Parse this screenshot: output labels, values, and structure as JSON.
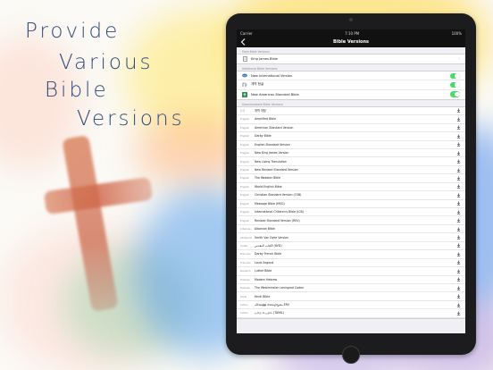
{
  "promo": {
    "line1": "Provide",
    "line2": "Various",
    "line3": "Bible",
    "line4": "Versions"
  },
  "status_bar": {
    "carrier": "Carrier",
    "time": "7:10 PM",
    "battery": "100%"
  },
  "nav": {
    "title": "Bible Versions",
    "back_icon": "chevron-left-icon"
  },
  "main_bible": {
    "header": "Main Bible Versions",
    "item": {
      "label": "King James Bible",
      "icon": "book-icon"
    }
  },
  "additional": {
    "header": "Additional Bible Versions",
    "items": [
      {
        "label": "New International Version",
        "icon": "niv-logo-icon",
        "enabled": true
      },
      {
        "label": "개역 한글",
        "icon": "korean-bible-icon",
        "enabled": true
      },
      {
        "label": "New American Standard Bible",
        "icon": "nasb-logo-icon",
        "enabled": true
      }
    ]
  },
  "downloadable": {
    "header": "Downloadable Bible Versions",
    "download_icon": "download-icon",
    "items": [
      {
        "lang": "한국",
        "name": "개역 개정"
      },
      {
        "lang": "English",
        "name": "Amplified Bible"
      },
      {
        "lang": "English",
        "name": "American Standard Version"
      },
      {
        "lang": "English",
        "name": "Darby Bible"
      },
      {
        "lang": "English",
        "name": "English Standard Version"
      },
      {
        "lang": "English",
        "name": "New King James Version"
      },
      {
        "lang": "English",
        "name": "New Living Translation"
      },
      {
        "lang": "English",
        "name": "New Revised Standard Version"
      },
      {
        "lang": "English",
        "name": "The Webster Bible"
      },
      {
        "lang": "English",
        "name": "World English Bible"
      },
      {
        "lang": "English",
        "name": "Christian Standard Version (CSB)"
      },
      {
        "lang": "English",
        "name": "Message Bible (MSG)"
      },
      {
        "lang": "English",
        "name": "International Children's Bible (ICB)"
      },
      {
        "lang": "English",
        "name": "Revised Standard Version (RSV)"
      },
      {
        "lang": "Albanian",
        "name": "Albanian Bible"
      },
      {
        "lang": "Afrikaans",
        "name": "Smith Van Dyke Version"
      },
      {
        "lang": "Arabic",
        "name": "الكتاب المقدس (AVD)"
      },
      {
        "lang": "Français",
        "name": "Darby French Bible"
      },
      {
        "lang": "Français",
        "name": "Louis Segond"
      },
      {
        "lang": "Deutsch",
        "name": "Luther Bible"
      },
      {
        "lang": "Hebrew",
        "name": "Modern Hebrew"
      },
      {
        "lang": "Hebrew",
        "name": "The Westminster Leningrad Codex"
      },
      {
        "lang": "Hindi",
        "name": "Hindi Bible"
      },
      {
        "lang": "Indian",
        "name": "ചിറകുള്ള വേദപുസ്തകം ERV"
      },
      {
        "lang": "Indian",
        "name": "தமிழ் பைபிள் (TAMIL)"
      }
    ]
  },
  "colors": {
    "nav_bg": "#111111",
    "toggle_on": "#4cd964",
    "promo_text": "#2f4a7a",
    "cross": "#cf6a4a"
  }
}
